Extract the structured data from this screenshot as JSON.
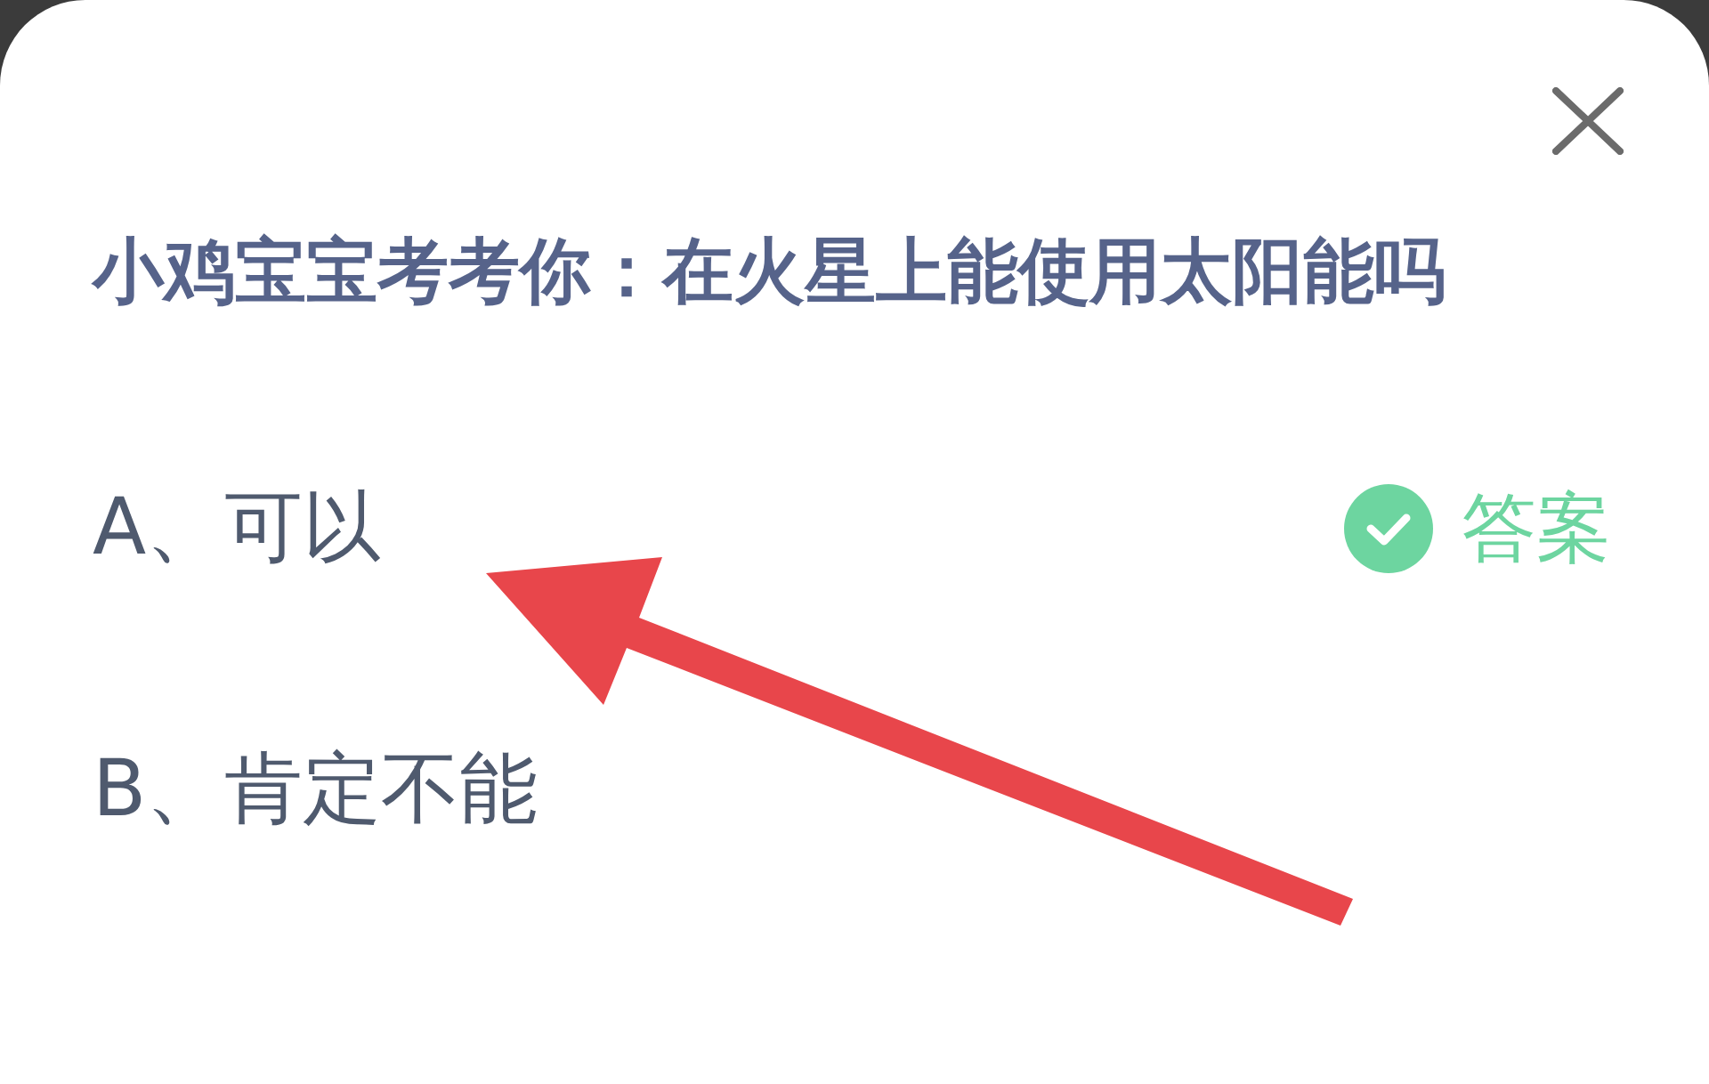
{
  "dialog": {
    "title": "小鸡宝宝考考你：在火星上能使用太阳能吗",
    "answer_label": "答案",
    "options": [
      {
        "label": "A、可以",
        "correct": true
      },
      {
        "label": "B、肯定不能",
        "correct": false
      }
    ]
  },
  "annotations": [
    {
      "kind": "arrow"
    }
  ]
}
